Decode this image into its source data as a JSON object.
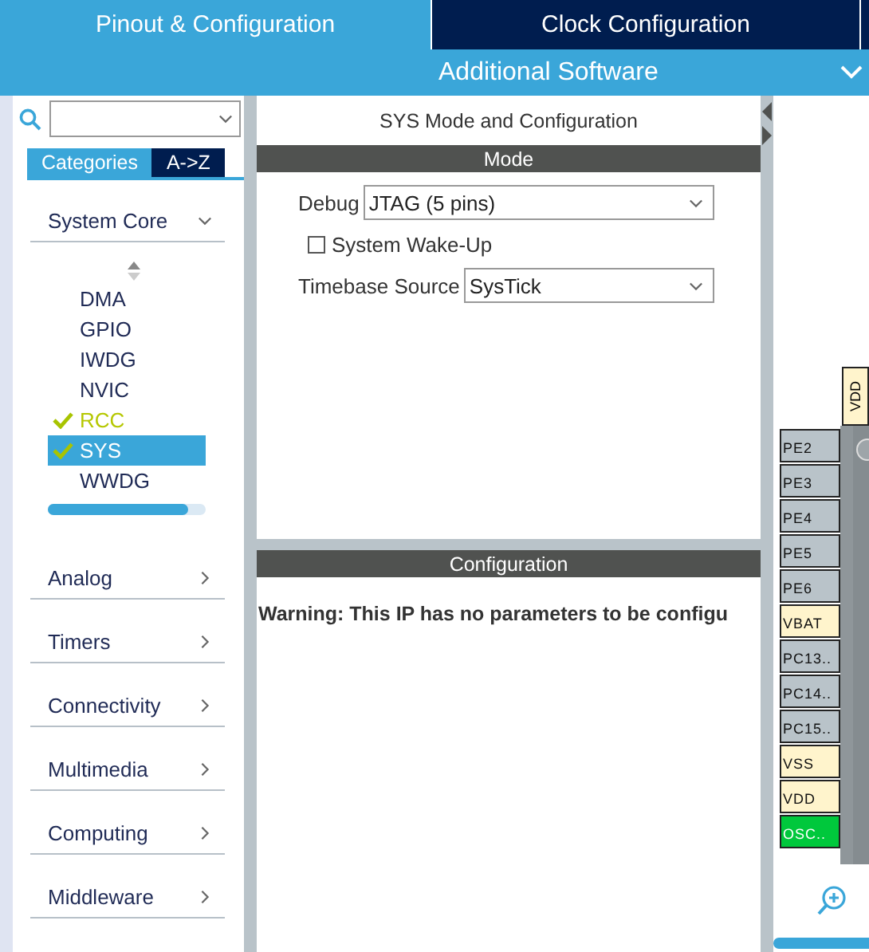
{
  "tabs": [
    {
      "label": "Pinout & Configuration",
      "selected": true
    },
    {
      "label": "Clock Configuration",
      "selected": false
    }
  ],
  "subbar": {
    "label": "Additional Software"
  },
  "view_tabs": [
    {
      "label": "Categories",
      "selected": true
    },
    {
      "label": "A->Z",
      "selected": false
    }
  ],
  "categories": [
    {
      "label": "System Core",
      "expanded": true,
      "items": [
        {
          "label": "DMA",
          "checked": false,
          "selected": false
        },
        {
          "label": "GPIO",
          "checked": false,
          "selected": false
        },
        {
          "label": "IWDG",
          "checked": false,
          "selected": false
        },
        {
          "label": "NVIC",
          "checked": false,
          "selected": false
        },
        {
          "label": "RCC",
          "checked": true,
          "selected": false
        },
        {
          "label": "SYS",
          "checked": true,
          "selected": true
        },
        {
          "label": "WWDG",
          "checked": false,
          "selected": false
        }
      ]
    },
    {
      "label": "Analog",
      "expanded": false
    },
    {
      "label": "Timers",
      "expanded": false
    },
    {
      "label": "Connectivity",
      "expanded": false
    },
    {
      "label": "Multimedia",
      "expanded": false
    },
    {
      "label": "Computing",
      "expanded": false
    },
    {
      "label": "Middleware",
      "expanded": false
    }
  ],
  "panel": {
    "title": "SYS Mode and Configuration",
    "mode_header": "Mode",
    "fields": [
      {
        "kind": "select",
        "label": "Debug",
        "value": "JTAG (5 pins)"
      },
      {
        "kind": "checkbox",
        "label": "System Wake-Up",
        "checked": false
      },
      {
        "kind": "select",
        "label": "Timebase Source",
        "value": "SysTick"
      }
    ],
    "config_header": "Configuration",
    "warning": "Warning: This IP has no parameters to be configu"
  },
  "pinout": {
    "top_pins": [
      {
        "label": "VDD",
        "color": "#fff4cc"
      }
    ],
    "pins": [
      {
        "label": "PE2",
        "color": "#b9c3c9"
      },
      {
        "label": "PE3",
        "color": "#b9c3c9"
      },
      {
        "label": "PE4",
        "color": "#b9c3c9"
      },
      {
        "label": "PE5",
        "color": "#b9c3c9"
      },
      {
        "label": "PE6",
        "color": "#b9c3c9"
      },
      {
        "label": "VBAT",
        "color": "#fff4cc"
      },
      {
        "label": "PC13..",
        "color": "#b9c3c9"
      },
      {
        "label": "PC14..",
        "color": "#b9c3c9"
      },
      {
        "label": "PC15..",
        "color": "#b9c3c9"
      },
      {
        "label": "VSS",
        "color": "#fff4cc"
      },
      {
        "label": "VDD",
        "color": "#fff4cc"
      },
      {
        "label": "OSC..",
        "color": "#00c83c"
      }
    ]
  }
}
